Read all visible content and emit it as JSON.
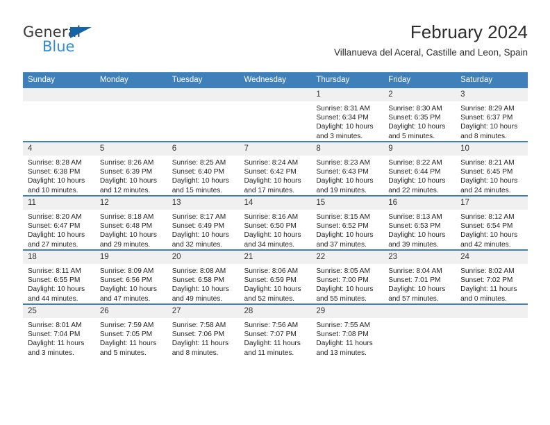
{
  "brand": {
    "name_part1": "General",
    "name_part2": "Blue"
  },
  "header": {
    "title": "February 2024",
    "subtitle": "Villanueva del Aceral, Castille and Leon, Spain"
  },
  "colors": {
    "header_blue": "#3f7fba",
    "daynum_gray": "#f0f0f0",
    "brand_blue": "#2e8bd4",
    "brand_triangle": "#1564a8"
  },
  "weekdays": [
    "Sunday",
    "Monday",
    "Tuesday",
    "Wednesday",
    "Thursday",
    "Friday",
    "Saturday"
  ],
  "weeks": [
    [
      {
        "day": "",
        "sunrise": "",
        "sunset": "",
        "daylight": ""
      },
      {
        "day": "",
        "sunrise": "",
        "sunset": "",
        "daylight": ""
      },
      {
        "day": "",
        "sunrise": "",
        "sunset": "",
        "daylight": ""
      },
      {
        "day": "",
        "sunrise": "",
        "sunset": "",
        "daylight": ""
      },
      {
        "day": "1",
        "sunrise": "Sunrise: 8:31 AM",
        "sunset": "Sunset: 6:34 PM",
        "daylight": "Daylight: 10 hours and 3 minutes."
      },
      {
        "day": "2",
        "sunrise": "Sunrise: 8:30 AM",
        "sunset": "Sunset: 6:35 PM",
        "daylight": "Daylight: 10 hours and 5 minutes."
      },
      {
        "day": "3",
        "sunrise": "Sunrise: 8:29 AM",
        "sunset": "Sunset: 6:37 PM",
        "daylight": "Daylight: 10 hours and 8 minutes."
      }
    ],
    [
      {
        "day": "4",
        "sunrise": "Sunrise: 8:28 AM",
        "sunset": "Sunset: 6:38 PM",
        "daylight": "Daylight: 10 hours and 10 minutes."
      },
      {
        "day": "5",
        "sunrise": "Sunrise: 8:26 AM",
        "sunset": "Sunset: 6:39 PM",
        "daylight": "Daylight: 10 hours and 12 minutes."
      },
      {
        "day": "6",
        "sunrise": "Sunrise: 8:25 AM",
        "sunset": "Sunset: 6:40 PM",
        "daylight": "Daylight: 10 hours and 15 minutes."
      },
      {
        "day": "7",
        "sunrise": "Sunrise: 8:24 AM",
        "sunset": "Sunset: 6:42 PM",
        "daylight": "Daylight: 10 hours and 17 minutes."
      },
      {
        "day": "8",
        "sunrise": "Sunrise: 8:23 AM",
        "sunset": "Sunset: 6:43 PM",
        "daylight": "Daylight: 10 hours and 19 minutes."
      },
      {
        "day": "9",
        "sunrise": "Sunrise: 8:22 AM",
        "sunset": "Sunset: 6:44 PM",
        "daylight": "Daylight: 10 hours and 22 minutes."
      },
      {
        "day": "10",
        "sunrise": "Sunrise: 8:21 AM",
        "sunset": "Sunset: 6:45 PM",
        "daylight": "Daylight: 10 hours and 24 minutes."
      }
    ],
    [
      {
        "day": "11",
        "sunrise": "Sunrise: 8:20 AM",
        "sunset": "Sunset: 6:47 PM",
        "daylight": "Daylight: 10 hours and 27 minutes."
      },
      {
        "day": "12",
        "sunrise": "Sunrise: 8:18 AM",
        "sunset": "Sunset: 6:48 PM",
        "daylight": "Daylight: 10 hours and 29 minutes."
      },
      {
        "day": "13",
        "sunrise": "Sunrise: 8:17 AM",
        "sunset": "Sunset: 6:49 PM",
        "daylight": "Daylight: 10 hours and 32 minutes."
      },
      {
        "day": "14",
        "sunrise": "Sunrise: 8:16 AM",
        "sunset": "Sunset: 6:50 PM",
        "daylight": "Daylight: 10 hours and 34 minutes."
      },
      {
        "day": "15",
        "sunrise": "Sunrise: 8:15 AM",
        "sunset": "Sunset: 6:52 PM",
        "daylight": "Daylight: 10 hours and 37 minutes."
      },
      {
        "day": "16",
        "sunrise": "Sunrise: 8:13 AM",
        "sunset": "Sunset: 6:53 PM",
        "daylight": "Daylight: 10 hours and 39 minutes."
      },
      {
        "day": "17",
        "sunrise": "Sunrise: 8:12 AM",
        "sunset": "Sunset: 6:54 PM",
        "daylight": "Daylight: 10 hours and 42 minutes."
      }
    ],
    [
      {
        "day": "18",
        "sunrise": "Sunrise: 8:11 AM",
        "sunset": "Sunset: 6:55 PM",
        "daylight": "Daylight: 10 hours and 44 minutes."
      },
      {
        "day": "19",
        "sunrise": "Sunrise: 8:09 AM",
        "sunset": "Sunset: 6:56 PM",
        "daylight": "Daylight: 10 hours and 47 minutes."
      },
      {
        "day": "20",
        "sunrise": "Sunrise: 8:08 AM",
        "sunset": "Sunset: 6:58 PM",
        "daylight": "Daylight: 10 hours and 49 minutes."
      },
      {
        "day": "21",
        "sunrise": "Sunrise: 8:06 AM",
        "sunset": "Sunset: 6:59 PM",
        "daylight": "Daylight: 10 hours and 52 minutes."
      },
      {
        "day": "22",
        "sunrise": "Sunrise: 8:05 AM",
        "sunset": "Sunset: 7:00 PM",
        "daylight": "Daylight: 10 hours and 55 minutes."
      },
      {
        "day": "23",
        "sunrise": "Sunrise: 8:04 AM",
        "sunset": "Sunset: 7:01 PM",
        "daylight": "Daylight: 10 hours and 57 minutes."
      },
      {
        "day": "24",
        "sunrise": "Sunrise: 8:02 AM",
        "sunset": "Sunset: 7:02 PM",
        "daylight": "Daylight: 11 hours and 0 minutes."
      }
    ],
    [
      {
        "day": "25",
        "sunrise": "Sunrise: 8:01 AM",
        "sunset": "Sunset: 7:04 PM",
        "daylight": "Daylight: 11 hours and 3 minutes."
      },
      {
        "day": "26",
        "sunrise": "Sunrise: 7:59 AM",
        "sunset": "Sunset: 7:05 PM",
        "daylight": "Daylight: 11 hours and 5 minutes."
      },
      {
        "day": "27",
        "sunrise": "Sunrise: 7:58 AM",
        "sunset": "Sunset: 7:06 PM",
        "daylight": "Daylight: 11 hours and 8 minutes."
      },
      {
        "day": "28",
        "sunrise": "Sunrise: 7:56 AM",
        "sunset": "Sunset: 7:07 PM",
        "daylight": "Daylight: 11 hours and 11 minutes."
      },
      {
        "day": "29",
        "sunrise": "Sunrise: 7:55 AM",
        "sunset": "Sunset: 7:08 PM",
        "daylight": "Daylight: 11 hours and 13 minutes."
      },
      {
        "day": "",
        "sunrise": "",
        "sunset": "",
        "daylight": ""
      },
      {
        "day": "",
        "sunrise": "",
        "sunset": "",
        "daylight": ""
      }
    ]
  ]
}
